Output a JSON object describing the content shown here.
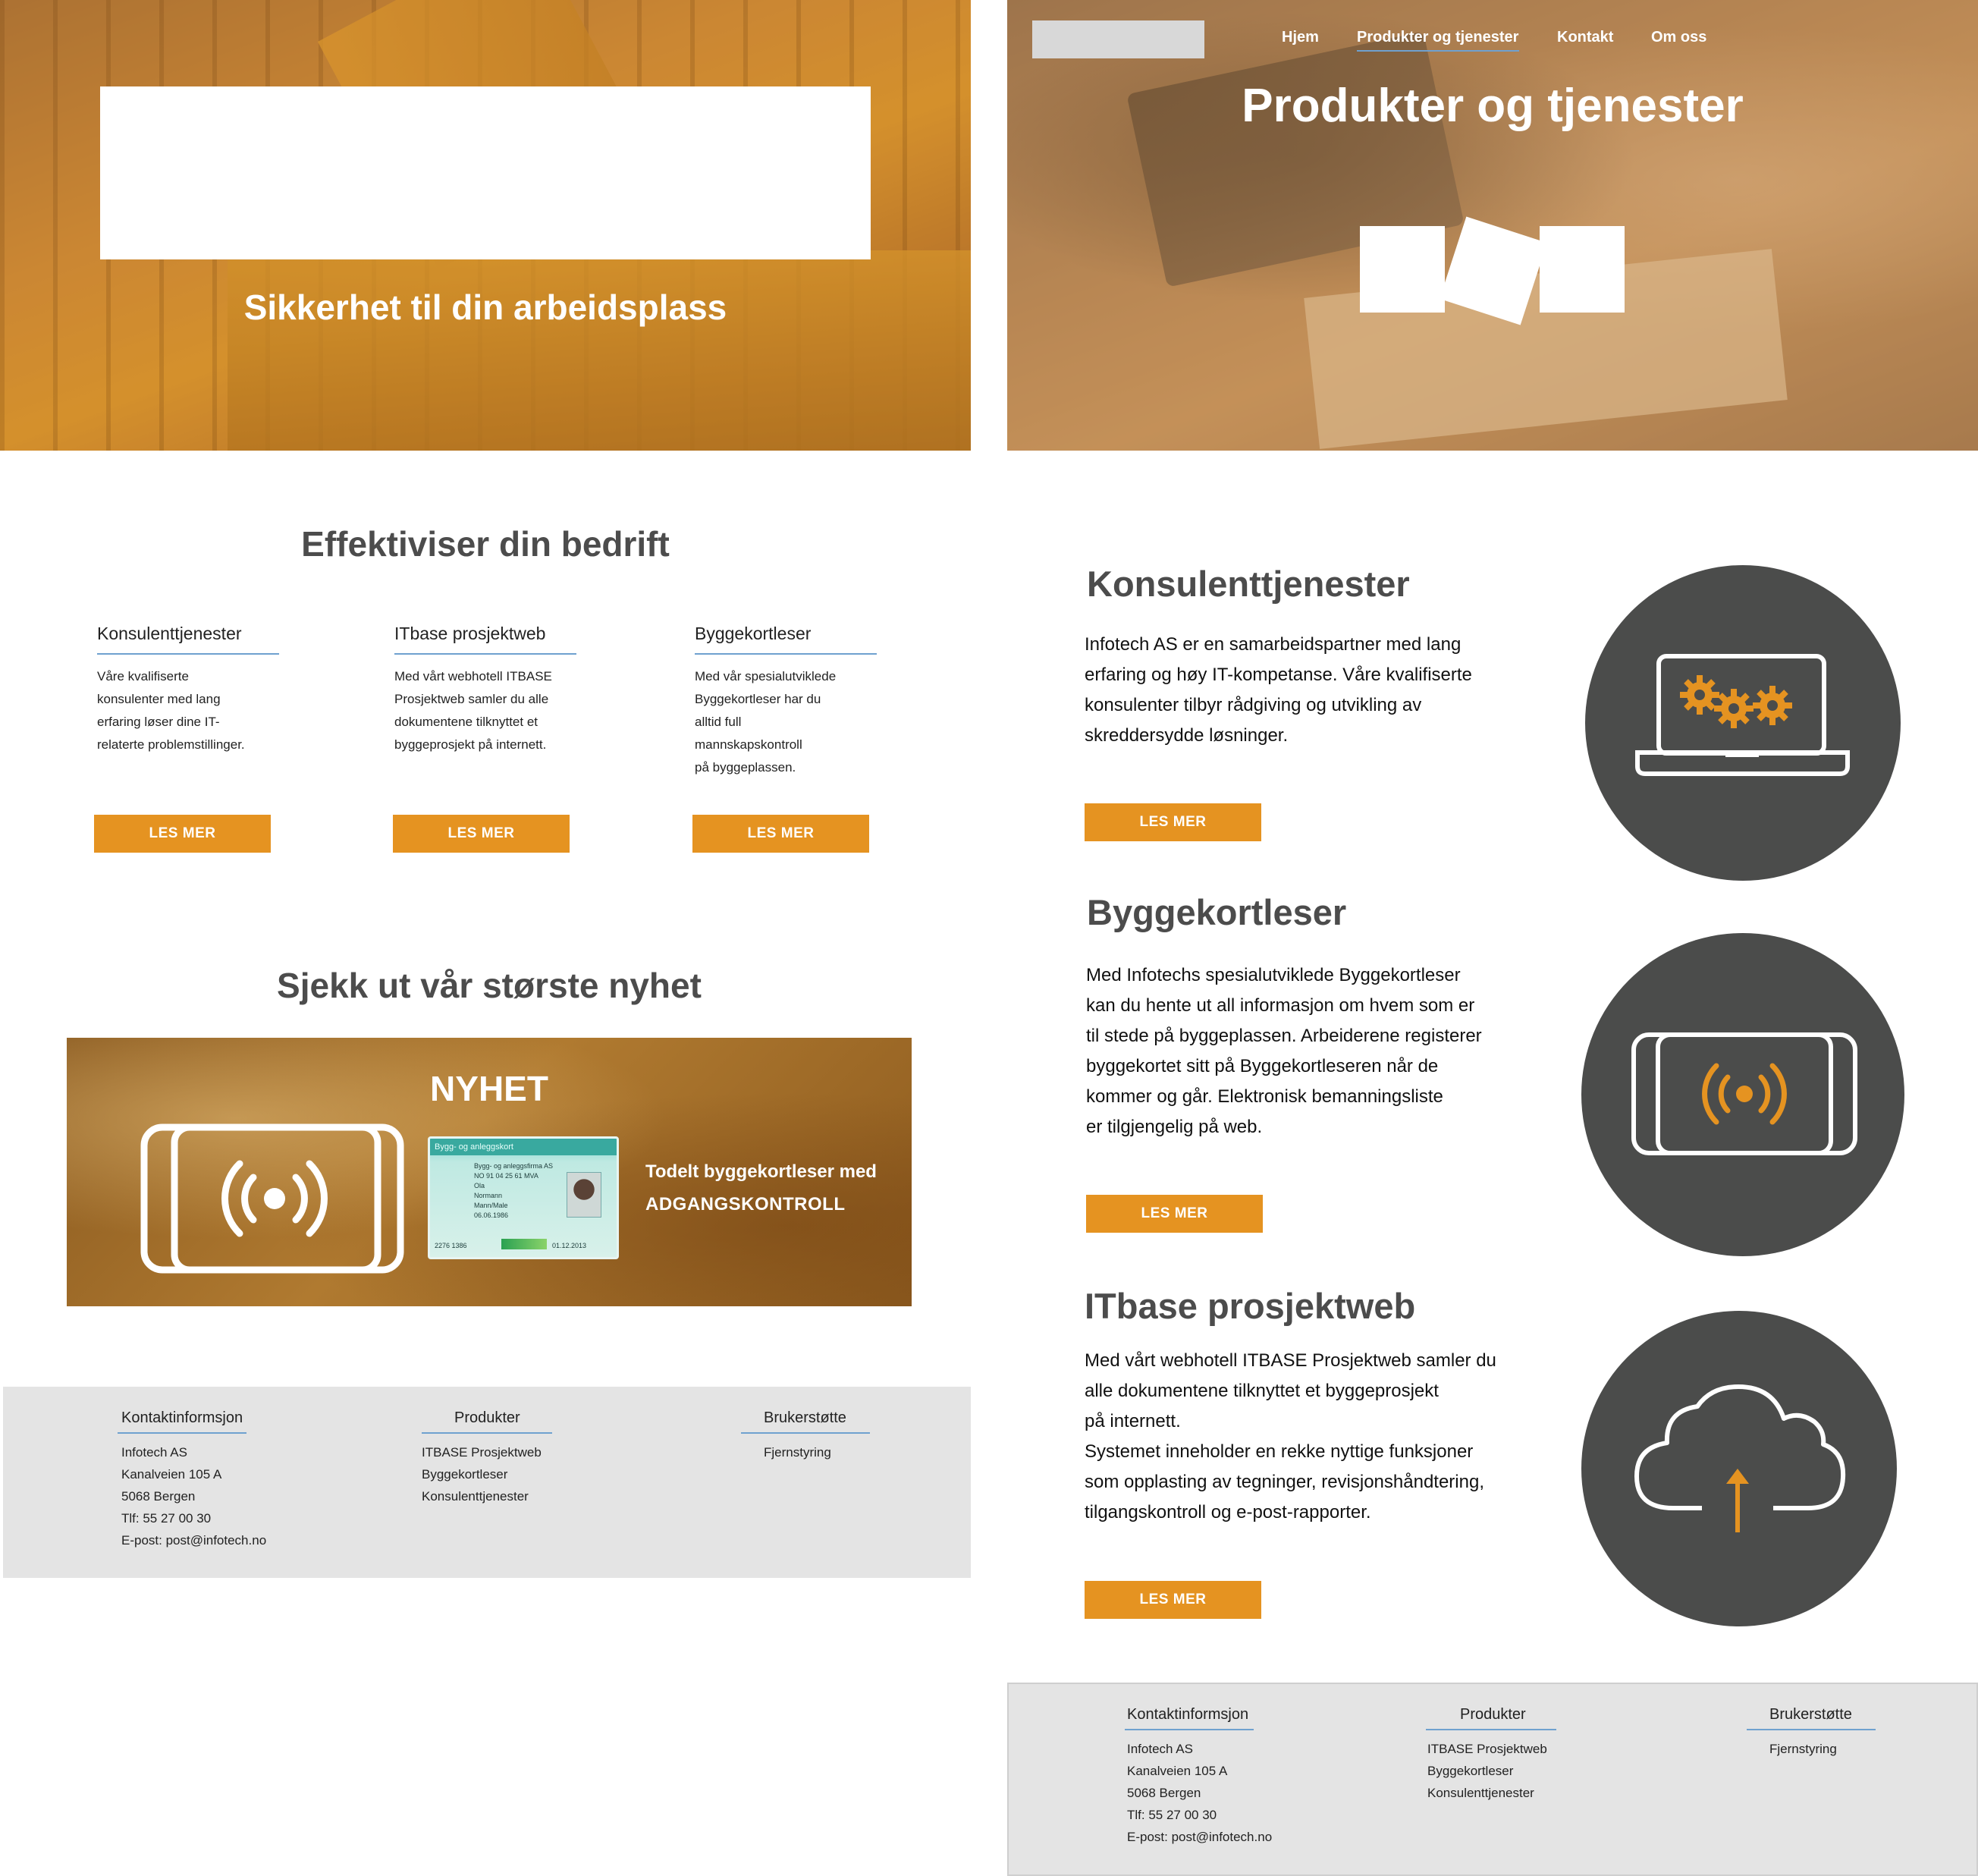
{
  "left_page": {
    "hero": {
      "title": "Sikkerhet til din arbeidsplass"
    },
    "effektiviser": {
      "title": "Effektiviser din bedrift",
      "columns": [
        {
          "title": "Konsulenttjenester",
          "text": "Våre kvalifiserte\nkonsulenter med lang\nerfaring løser dine IT-\nrelaterte problemstillinger.",
          "button": "LES MER"
        },
        {
          "title": "ITbase prosjektweb",
          "text": "Med vårt webhotell ITBASE\nProsjektweb samler du alle\ndokumentene tilknyttet et\nbyggeprosjekt på internett.",
          "button": "LES MER"
        },
        {
          "title": "Byggekortleser",
          "text": "Med vår spesialutviklede\nByggekortleser har du\nalltid full\nmannskapskontroll\npå byggeplassen.",
          "button": "LES MER"
        }
      ]
    },
    "news": {
      "section_title": "Sjekk ut vår største nyhet",
      "label": "NYHET",
      "line1": "Todelt byggekortleser med",
      "line2": "ADGANGSKONTROLL",
      "card": {
        "header": "Bygg- og anleggskort",
        "company": "Bygg- og anleggsfirma AS",
        "org": "NO 91 04 25 61 MVA",
        "first": "Ola",
        "last": "Normann",
        "gender": "Mann/Male",
        "birth": "06.06.1986",
        "number": "2276 1386",
        "valid": "01.12.2013"
      }
    }
  },
  "footer": {
    "contact": {
      "title": "Kontaktinformsjon",
      "lines": [
        "Infotech AS",
        "Kanalveien 105 A",
        "5068 Bergen",
        "Tlf: 55 27 00 30",
        "E-post: post@infotech.no"
      ]
    },
    "products": {
      "title": "Produkter",
      "lines": [
        "ITBASE Prosjektweb",
        "Byggekortleser",
        "Konsulenttjenester"
      ]
    },
    "support": {
      "title": "Brukerstøtte",
      "lines": [
        "Fjernstyring"
      ]
    }
  },
  "right_page": {
    "nav": {
      "items": [
        "Hjem",
        "Produkter og tjenester",
        "Kontakt",
        "Om oss"
      ],
      "active": "Produkter og tjenester"
    },
    "hero": {
      "title": "Produkter og tjenester"
    },
    "services": [
      {
        "title": "Konsulenttjenester",
        "text": "Infotech AS er en samarbeidspartner med lang\nerfaring og høy IT-kompetanse. Våre kvalifiserte\nkonsulenter tilbyr rådgiving og utvikling av\nskreddersydde løsninger.",
        "button": "LES MER",
        "icon": "laptop-gears-icon"
      },
      {
        "title": "Byggekortleser",
        "text": "Med Infotechs spesialutviklede Byggekortleser\nkan du hente ut all informasjon om hvem som er\ntil stede på byggeplassen. Arbeiderene registerer\nbyggekortet sitt på Byggekortleseren når de\nkommer og går. Elektronisk bemanningsliste\ner tilgjengelig på web.",
        "button": "LES MER",
        "icon": "card-reader-icon"
      },
      {
        "title": "ITbase prosjektweb",
        "text": "Med vårt webhotell ITBASE Prosjektweb samler du\nalle dokumentene tilknyttet et byggeprosjekt\npå internett.\nSystemet inneholder en rekke nyttige funksjoner\nsom opplasting av tegninger, revisjonshåndtering,\ntilgangskontroll og e-post-rapporter.",
        "button": "LES MER",
        "icon": "cloud-upload-icon"
      }
    ]
  },
  "colors": {
    "accent": "#e59321",
    "rule": "#6fa1cf",
    "heading": "#4c4c4c",
    "circle": "#4b4c4b",
    "footer_bg": "#e4e4e4"
  }
}
